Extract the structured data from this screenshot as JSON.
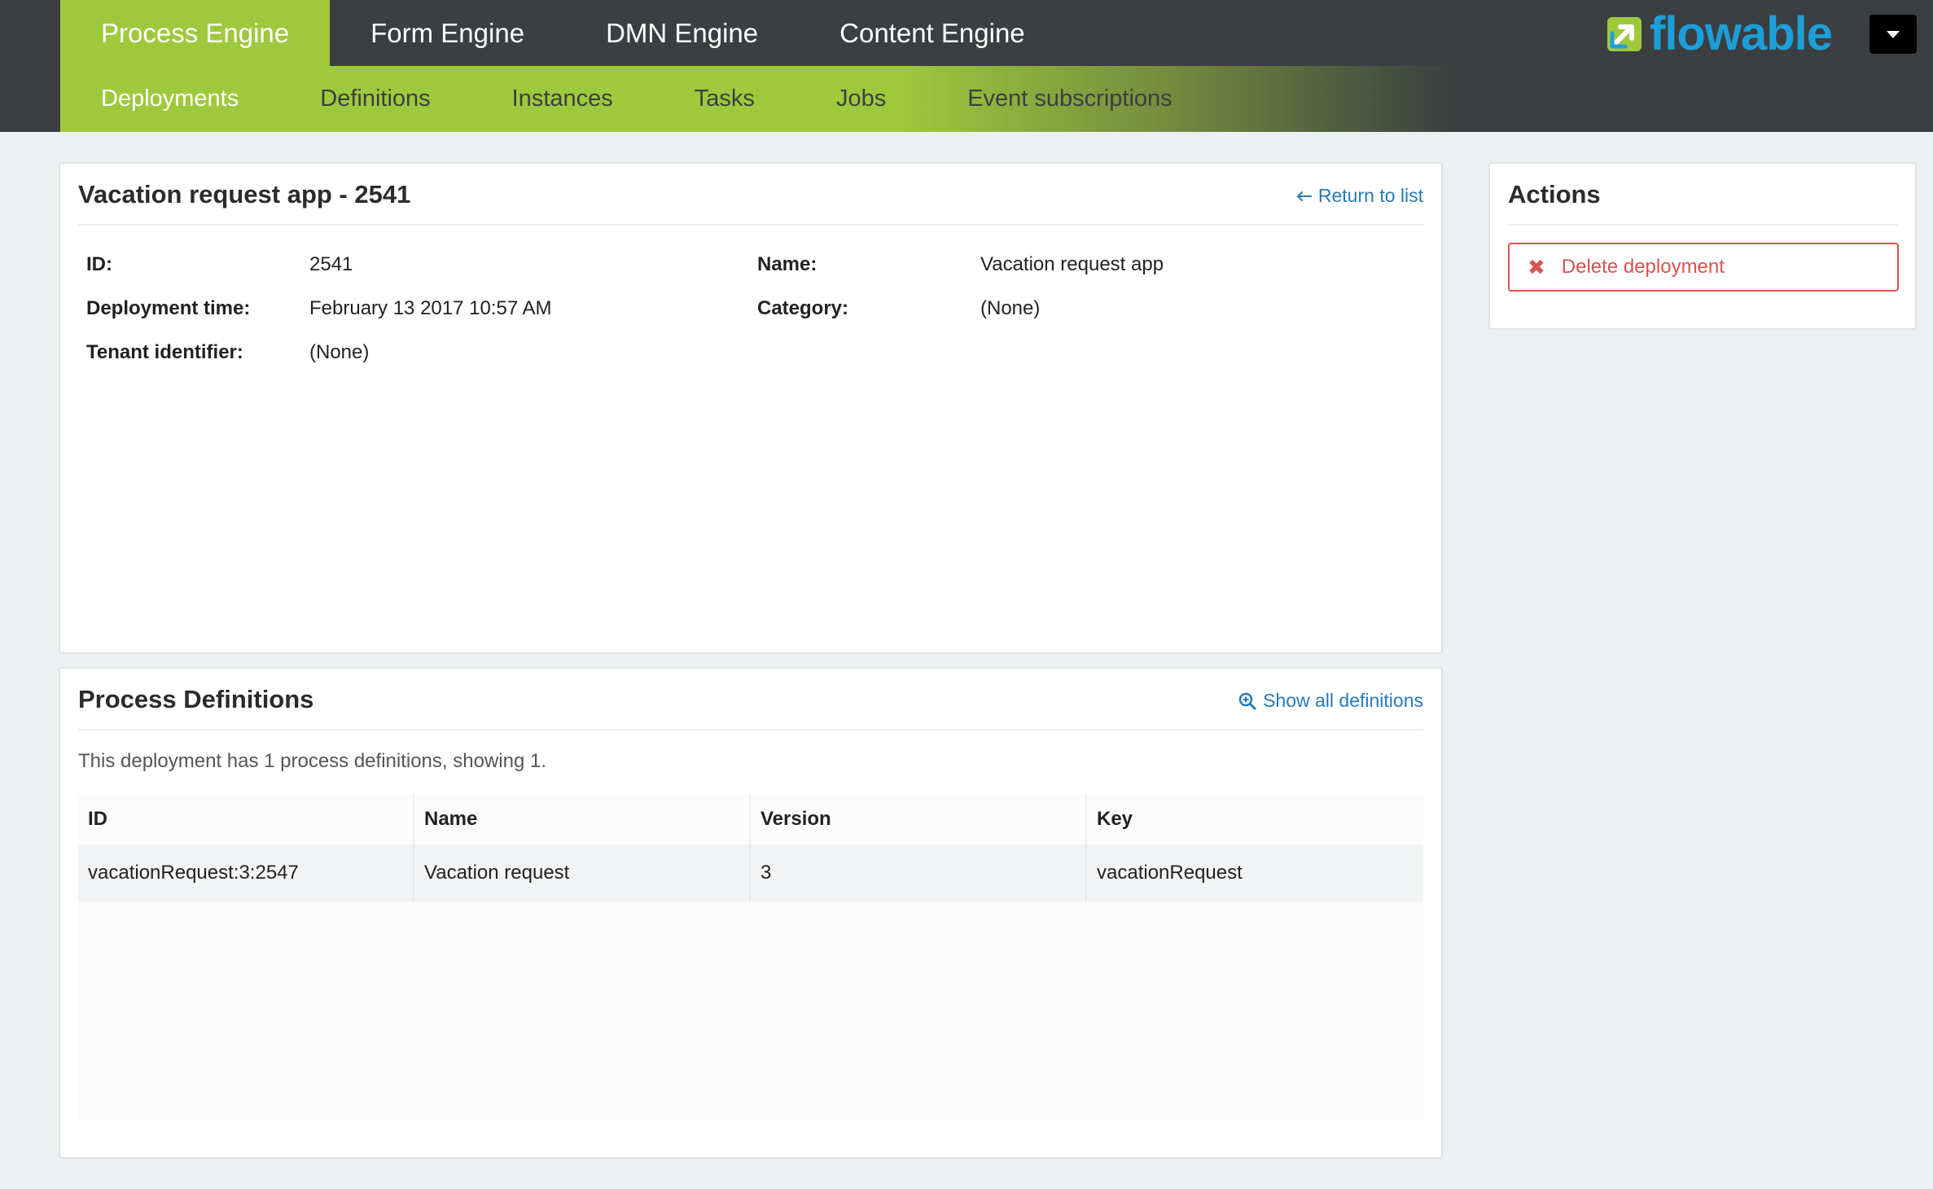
{
  "top_nav": {
    "tabs": [
      {
        "label": "Process Engine",
        "active": true
      },
      {
        "label": "Form Engine",
        "active": false
      },
      {
        "label": "DMN Engine",
        "active": false
      },
      {
        "label": "Content Engine",
        "active": false
      }
    ]
  },
  "sub_nav": {
    "tabs": [
      {
        "label": "Deployments",
        "active": true
      },
      {
        "label": "Definitions",
        "active": false
      },
      {
        "label": "Instances",
        "active": false
      },
      {
        "label": "Tasks",
        "active": false
      },
      {
        "label": "Jobs",
        "active": false
      },
      {
        "label": "Event subscriptions",
        "active": false
      }
    ]
  },
  "brand": {
    "logo_text": "flowable",
    "logo_color": "#1c9fd8",
    "accent_color": "#9fc93c"
  },
  "user_menu": {
    "icon": "caret-down-icon"
  },
  "deployment": {
    "title": "Vacation request app - 2541",
    "return_link": "Return to list",
    "return_icon": "arrow-left-icon",
    "fields": {
      "id_label": "ID:",
      "id_value": "2541",
      "name_label": "Name:",
      "name_value": "Vacation request app",
      "time_label": "Deployment time:",
      "time_value": "February 13 2017 10:57 AM",
      "category_label": "Category:",
      "category_value": "(None)",
      "tenant_label": "Tenant identifier:",
      "tenant_value": "(None)"
    }
  },
  "process_definitions": {
    "title": "Process Definitions",
    "show_all_link": "Show all definitions",
    "show_all_icon": "zoom-in-icon",
    "summary": "This deployment has 1 process definitions, showing 1.",
    "columns": [
      "ID",
      "Name",
      "Version",
      "Key"
    ],
    "rows": [
      [
        "vacationRequest:3:2547",
        "Vacation request",
        "3",
        "vacationRequest"
      ]
    ]
  },
  "actions": {
    "title": "Actions",
    "delete_label": "Delete deployment",
    "delete_icon": "close-icon",
    "danger_color": "#d9534f"
  }
}
